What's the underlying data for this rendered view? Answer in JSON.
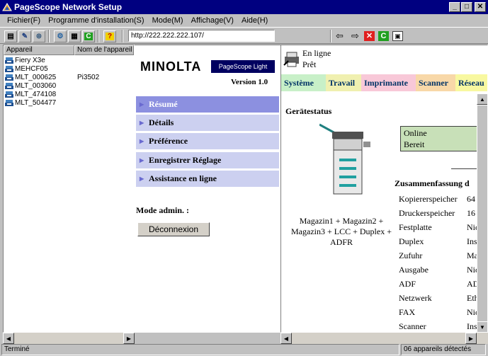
{
  "window": {
    "title": "PageScope Network Setup"
  },
  "menu": {
    "items": [
      "Fichier(F)",
      "Programme d'installation(S)",
      "Mode(M)",
      "Affichage(V)",
      "Aide(H)"
    ]
  },
  "toolbar": {
    "url": "http://222.222.222.107/"
  },
  "device_list": {
    "col_device": "Appareil",
    "col_printer": "Nom de l'appareil",
    "rows": [
      {
        "name": "Fiery X3e",
        "model": ""
      },
      {
        "name": "MEHCF05",
        "model": ""
      },
      {
        "name": "MLT_000625",
        "model": "Pi3502"
      },
      {
        "name": "MLT_003060",
        "model": ""
      },
      {
        "name": "MLT_474108",
        "model": ""
      },
      {
        "name": "MLT_504477",
        "model": ""
      }
    ]
  },
  "web": {
    "status_online": "En ligne",
    "status_ready": "Prêt",
    "logo_text": "MINOLTA",
    "pagescope_text": "PageScope Light",
    "version": "Version 1.0",
    "nav": [
      "Résumé",
      "Détails",
      "Préférence",
      "Enregistrer Réglage",
      "Assistance en ligne"
    ],
    "admin_mode": "Mode admin. :",
    "logout_button": "Déconnexion",
    "tabs": [
      "Système",
      "Travail",
      "Imprimante",
      "Scanner",
      "Réseau"
    ],
    "tab_colors": [
      "#c8f0c8",
      "#f0f0b0",
      "#f8c8d8",
      "#f8d8a8",
      "#f8f8a0"
    ],
    "device_status_title": "Gerätestatus",
    "status_box_line1": "Online",
    "status_box_line2": "Bereit",
    "options_caption": "Magazin1 + Magazin2 + Magazin3 + LCC + Duplex + ADFR",
    "summary_title": "Zusammenfassung d",
    "summary": [
      {
        "k": "Kopiererspeicher",
        "v": "64 ("
      },
      {
        "k": "Druckerspeicher",
        "v": "16 ·"
      },
      {
        "k": "Festplatte",
        "v": "Nic"
      },
      {
        "k": "Duplex",
        "v": "Inst"
      },
      {
        "k": "Zufuhr",
        "v": "Ma"
      },
      {
        "k": "Ausgabe",
        "v": "Nic"
      },
      {
        "k": "ADF",
        "v": "AD"
      },
      {
        "k": "Netzwerk",
        "v": "Eth"
      },
      {
        "k": "FAX",
        "v": "Nic"
      },
      {
        "k": "Scanner",
        "v": "Inst"
      }
    ]
  },
  "status": {
    "left": "Terminé",
    "right": "06 appareils détectés"
  }
}
